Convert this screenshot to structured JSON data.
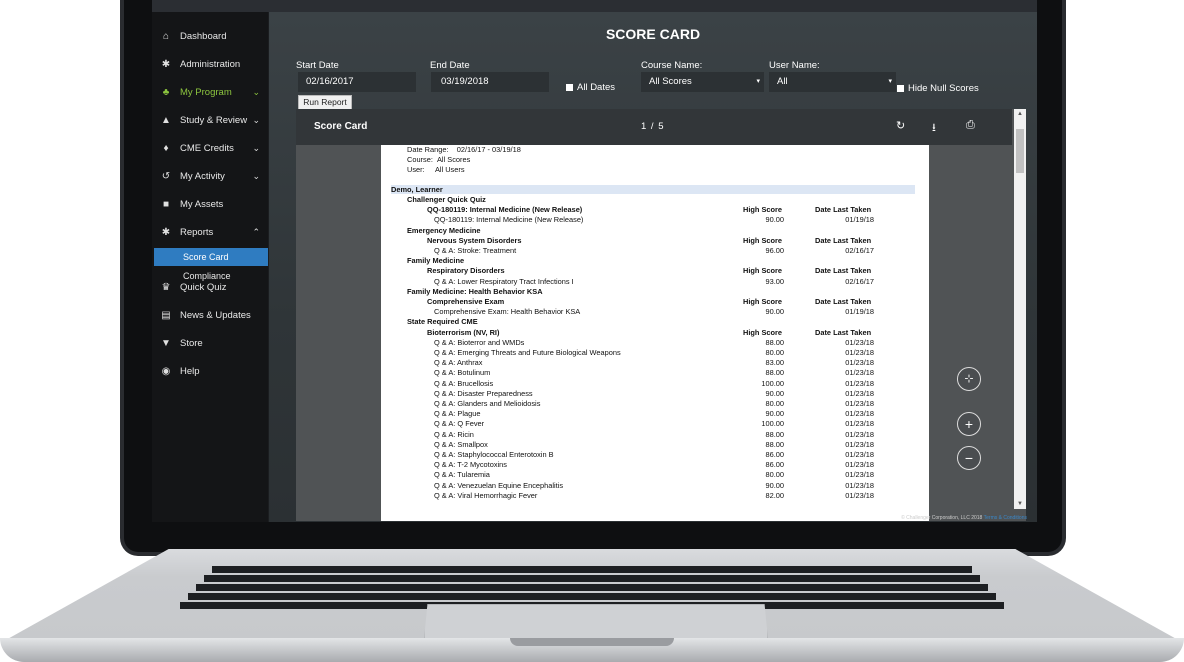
{
  "sidebar": {
    "items": [
      {
        "label": "Dashboard",
        "icon": "home-icon",
        "glyph": "⌂"
      },
      {
        "label": "Administration",
        "icon": "wrench-icon",
        "glyph": "✱"
      },
      {
        "label": "My Program",
        "icon": "users-icon",
        "glyph": "♣",
        "chev": "⌄"
      },
      {
        "label": "Study & Review",
        "icon": "graduation-cap-icon",
        "glyph": "▲",
        "chev": "⌄"
      },
      {
        "label": "CME Credits",
        "icon": "bell-icon",
        "glyph": "♦",
        "chev": "⌄"
      },
      {
        "label": "My Activity",
        "icon": "history-icon",
        "glyph": "↺",
        "chev": "⌄"
      },
      {
        "label": "My Assets",
        "icon": "bookmark-icon",
        "glyph": "■"
      },
      {
        "label": "Reports",
        "icon": "wrench-icon",
        "glyph": "✱",
        "chev": "⌃"
      },
      {
        "label": "Quick Quiz",
        "icon": "trophy-icon",
        "glyph": "♛"
      },
      {
        "label": "News & Updates",
        "icon": "newspaper-icon",
        "glyph": "▤"
      },
      {
        "label": "Store",
        "icon": "cart-icon",
        "glyph": "▼"
      },
      {
        "label": "Help",
        "icon": "life-ring-icon",
        "glyph": "◉"
      }
    ],
    "subitems": [
      "Score Card",
      "Compliance"
    ]
  },
  "page": {
    "title": "SCORE CARD"
  },
  "filters": {
    "start_date_label": "Start Date",
    "start_date": "02/16/2017",
    "end_date_label": "End Date",
    "end_date": "03/19/2018",
    "all_dates_label": "All Dates",
    "course_label": "Course Name:",
    "course_value": "All Scores",
    "user_label": "User Name:",
    "user_value": "All",
    "hide_null_label": "Hide Null Scores",
    "select_arrow": "▾",
    "run_report": "Run Report"
  },
  "viewer": {
    "title": "Score Card",
    "page_indicator": "1 / 5",
    "refresh_glyph": "↻",
    "download_glyph": "⭳",
    "print_glyph": "⎙",
    "fit_glyph": "⊹",
    "zoom_in_glyph": "+",
    "zoom_out_glyph": "−"
  },
  "report": {
    "date_range_label": "Date Range:",
    "date_range": "02/16/17 - 03/19/18",
    "course_label": "Course:",
    "course": "All Scores",
    "user_label": "User:",
    "user": "All Users",
    "learner": "Demo, Learner",
    "high_score": "High Score",
    "date_last_taken": "Date Last Taken",
    "rows": [
      {
        "level": 1,
        "text": "Challenger Quick Quiz"
      },
      {
        "level": 2,
        "text": "QQ-180119: Internal Medicine (New Release)",
        "header": true
      },
      {
        "level": 3,
        "text": "QQ-180119: Internal Medicine (New Release)",
        "score": "90.00",
        "date": "01/19/18"
      },
      {
        "level": 1,
        "text": "Emergency Medicine"
      },
      {
        "level": 2,
        "text": "Nervous System Disorders",
        "header": true
      },
      {
        "level": 3,
        "text": "Q & A: Stroke: Treatment",
        "score": "96.00",
        "date": "02/16/17"
      },
      {
        "level": 1,
        "text": "Family Medicine"
      },
      {
        "level": 2,
        "text": "Respiratory Disorders",
        "header": true
      },
      {
        "level": 3,
        "text": "Q & A: Lower Respiratory Tract Infections I",
        "score": "93.00",
        "date": "02/16/17"
      },
      {
        "level": 1,
        "text": "Family Medicine: Health Behavior KSA"
      },
      {
        "level": 2,
        "text": "Comprehensive Exam",
        "header": true
      },
      {
        "level": 3,
        "text": "Comprehensive Exam: Health Behavior KSA",
        "score": "90.00",
        "date": "01/19/18"
      },
      {
        "level": 1,
        "text": "State Required CME"
      },
      {
        "level": 2,
        "text": "Bioterrorism (NV, RI)",
        "header": true
      },
      {
        "level": 3,
        "text": "Q & A: Bioterror and WMDs",
        "score": "88.00",
        "date": "01/23/18"
      },
      {
        "level": 3,
        "text": "Q & A: Emerging Threats and Future Biological Weapons",
        "score": "80.00",
        "date": "01/23/18"
      },
      {
        "level": 3,
        "text": "Q & A: Anthrax",
        "score": "83.00",
        "date": "01/23/18"
      },
      {
        "level": 3,
        "text": "Q & A: Botulinum",
        "score": "88.00",
        "date": "01/23/18"
      },
      {
        "level": 3,
        "text": "Q & A: Brucellosis",
        "score": "100.00",
        "date": "01/23/18"
      },
      {
        "level": 3,
        "text": "Q & A: Disaster Preparedness",
        "score": "90.00",
        "date": "01/23/18"
      },
      {
        "level": 3,
        "text": "Q & A: Glanders and Melioidosis",
        "score": "80.00",
        "date": "01/23/18"
      },
      {
        "level": 3,
        "text": "Q & A: Plague",
        "score": "90.00",
        "date": "01/23/18"
      },
      {
        "level": 3,
        "text": "Q & A: Q Fever",
        "score": "100.00",
        "date": "01/23/18"
      },
      {
        "level": 3,
        "text": "Q & A: Ricin",
        "score": "88.00",
        "date": "01/23/18"
      },
      {
        "level": 3,
        "text": "Q & A: Smallpox",
        "score": "88.00",
        "date": "01/23/18"
      },
      {
        "level": 3,
        "text": "Q & A: Staphylococcal Enterotoxin B",
        "score": "86.00",
        "date": "01/23/18"
      },
      {
        "level": 3,
        "text": "Q & A: T-2 Mycotoxins",
        "score": "86.00",
        "date": "01/23/18"
      },
      {
        "level": 3,
        "text": "Q & A: Tularemia",
        "score": "80.00",
        "date": "01/23/18"
      },
      {
        "level": 3,
        "text": "Q & A: Venezuelan Equine Encephalitis",
        "score": "90.00",
        "date": "01/23/18"
      },
      {
        "level": 3,
        "text": "Q & A: Viral Hemorrhagic Fever",
        "score": "82.00",
        "date": "01/23/18"
      }
    ]
  },
  "footer": {
    "copyright": "© Challenger Corporation, LLC 2018",
    "terms": "Terms & Conditions"
  }
}
